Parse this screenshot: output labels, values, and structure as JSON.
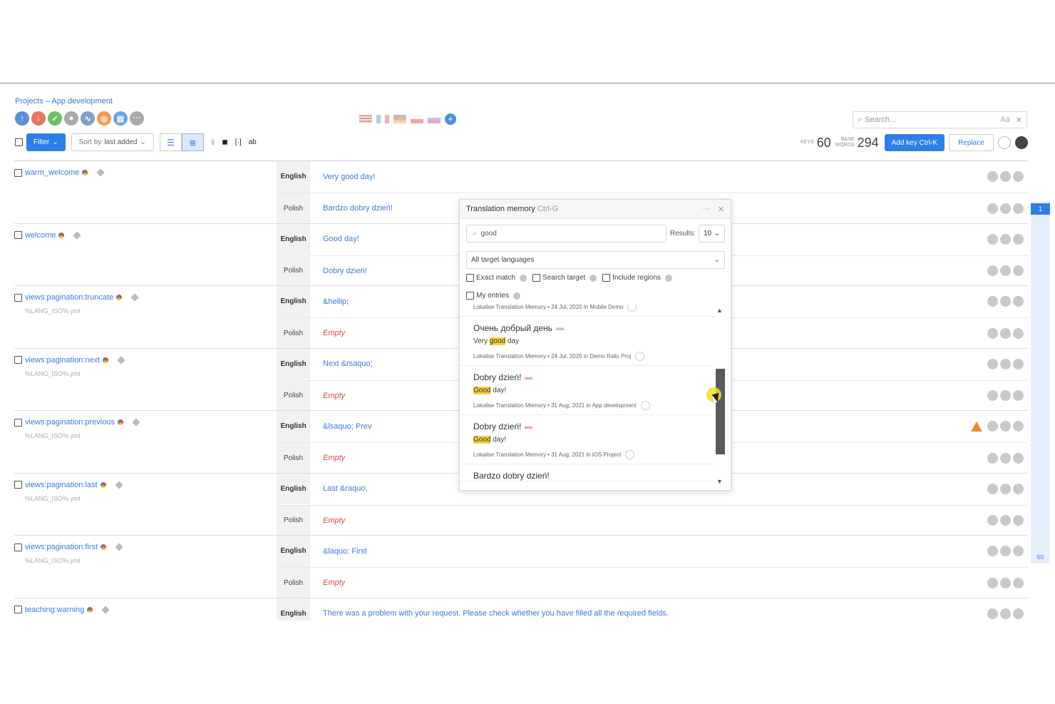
{
  "breadcrumb": "Projects – App development",
  "action_icons": [
    {
      "name": "upload-icon",
      "color": "#5b8fd8",
      "glyph": "↑"
    },
    {
      "name": "download-icon",
      "color": "#e87563",
      "glyph": "↓"
    },
    {
      "name": "check-icon",
      "color": "#6bbf6b",
      "glyph": "✓"
    },
    {
      "name": "users-icon",
      "color": "#aaaaaa",
      "glyph": "●"
    },
    {
      "name": "activity-icon",
      "color": "#7ea0c9",
      "glyph": "∿"
    },
    {
      "name": "screenshots-icon",
      "color": "#f19a55",
      "glyph": "◎"
    },
    {
      "name": "docs-icon",
      "color": "#6aa5df",
      "glyph": "▤"
    },
    {
      "name": "more-icon",
      "color": "#aaaaaa",
      "glyph": "···"
    }
  ],
  "search": {
    "placeholder": "Search...",
    "case_label": "Aa",
    "close": "✕"
  },
  "toolbar": {
    "filter_label": "Filter",
    "sort_prefix": "Sort by",
    "sort_value": "last added"
  },
  "stats": {
    "keys_label": "KEYS",
    "keys_value": "60",
    "base_words_label_1": "BASE",
    "base_words_label_2": "WORDS",
    "base_words_value": "294",
    "add_key_label": "Add key Ctrl-K",
    "replace_label": "Replace"
  },
  "keys": [
    {
      "name": "warm_welcome",
      "file": "",
      "rows": [
        {
          "lang": "English",
          "text": "Very good day!",
          "empty": false
        },
        {
          "lang": "Polish",
          "text": "Bardzo dobry dzień!",
          "empty": false
        }
      ]
    },
    {
      "name": "welcome",
      "file": "",
      "rows": [
        {
          "lang": "English",
          "text": "Good day!",
          "empty": false
        },
        {
          "lang": "Polish",
          "text": "Dobry dzień!",
          "empty": false
        }
      ]
    },
    {
      "name": "views:pagination:truncate",
      "file": "%LANG_ISO%.yml",
      "rows": [
        {
          "lang": "English",
          "text": "&hellip;",
          "empty": false
        },
        {
          "lang": "Polish",
          "text": "Empty",
          "empty": true
        }
      ]
    },
    {
      "name": "views:pagination:next",
      "file": "%LANG_ISO%.yml",
      "rows": [
        {
          "lang": "English",
          "text": "Next &rsaquo;",
          "empty": false
        },
        {
          "lang": "Polish",
          "text": "Empty",
          "empty": true
        }
      ]
    },
    {
      "name": "views:pagination:previous",
      "file": "%LANG_ISO%.yml",
      "rows": [
        {
          "lang": "English",
          "text": "&lsaquo; Prev",
          "empty": false,
          "warning": true
        },
        {
          "lang": "Polish",
          "text": "Empty",
          "empty": true
        }
      ]
    },
    {
      "name": "views:pagination:last",
      "file": "%LANG_ISO%.yml",
      "rows": [
        {
          "lang": "English",
          "text": "Last &raquo;",
          "empty": false
        },
        {
          "lang": "Polish",
          "text": "Empty",
          "empty": true
        }
      ]
    },
    {
      "name": "views:pagination:first",
      "file": "%LANG_ISO%.yml",
      "rows": [
        {
          "lang": "English",
          "text": "&laquo; First",
          "empty": false
        },
        {
          "lang": "Polish",
          "text": "Empty",
          "empty": true
        }
      ]
    },
    {
      "name": "teaching:warning",
      "file": "",
      "rows": [
        {
          "lang": "English",
          "text": "There was a problem with your request. Please check whether you have filled all the required fields.",
          "empty": false
        }
      ]
    }
  ],
  "pagination": {
    "current": "1",
    "last": "60"
  },
  "tm": {
    "title": "Translation memory",
    "shortcut": "Ctrl-G",
    "search_value": "good",
    "results_label": "Results:",
    "results_value": "10",
    "lang_select": "All target languages",
    "options": [
      "Exact match",
      "Search target",
      "Include regions"
    ],
    "options2": [
      "My entries"
    ],
    "items": [
      {
        "source": "",
        "target_pre": "",
        "target_hl": "",
        "target_post": "",
        "meta": "Lokalise Translation Memory • 24 Jul, 2020 in Mobile Demo",
        "flag": ""
      },
      {
        "source": "Очень добрый день",
        "target_pre": "Very ",
        "target_hl": "good",
        "target_post": " day",
        "meta": "Lokalise Translation Memory • 24 Jul, 2020 in Demo Rails Proj",
        "flag": "ru"
      },
      {
        "source": "Dobry dzień!",
        "target_pre": "",
        "target_hl": "Good",
        "target_post": " day!",
        "meta": "Lokalise Translation Memory • 31 Aug, 2021 in App development",
        "flag": "pl"
      },
      {
        "source": "Dobry dzień!",
        "target_pre": "",
        "target_hl": "Good",
        "target_post": " day!",
        "meta": "Lokalise Translation Memory • 31 Aug, 2021 in iOS Project",
        "flag": "pl"
      },
      {
        "source": "Bardzo dobry dzień!",
        "target_pre": "",
        "target_hl": "",
        "target_post": "",
        "meta": "",
        "flag": ""
      }
    ]
  },
  "colors": {
    "accent": "#2f7ee8",
    "link": "#3d7bd8",
    "empty": "#e0484a",
    "highlight": "#f7d23b",
    "warning": "#f08a24"
  }
}
